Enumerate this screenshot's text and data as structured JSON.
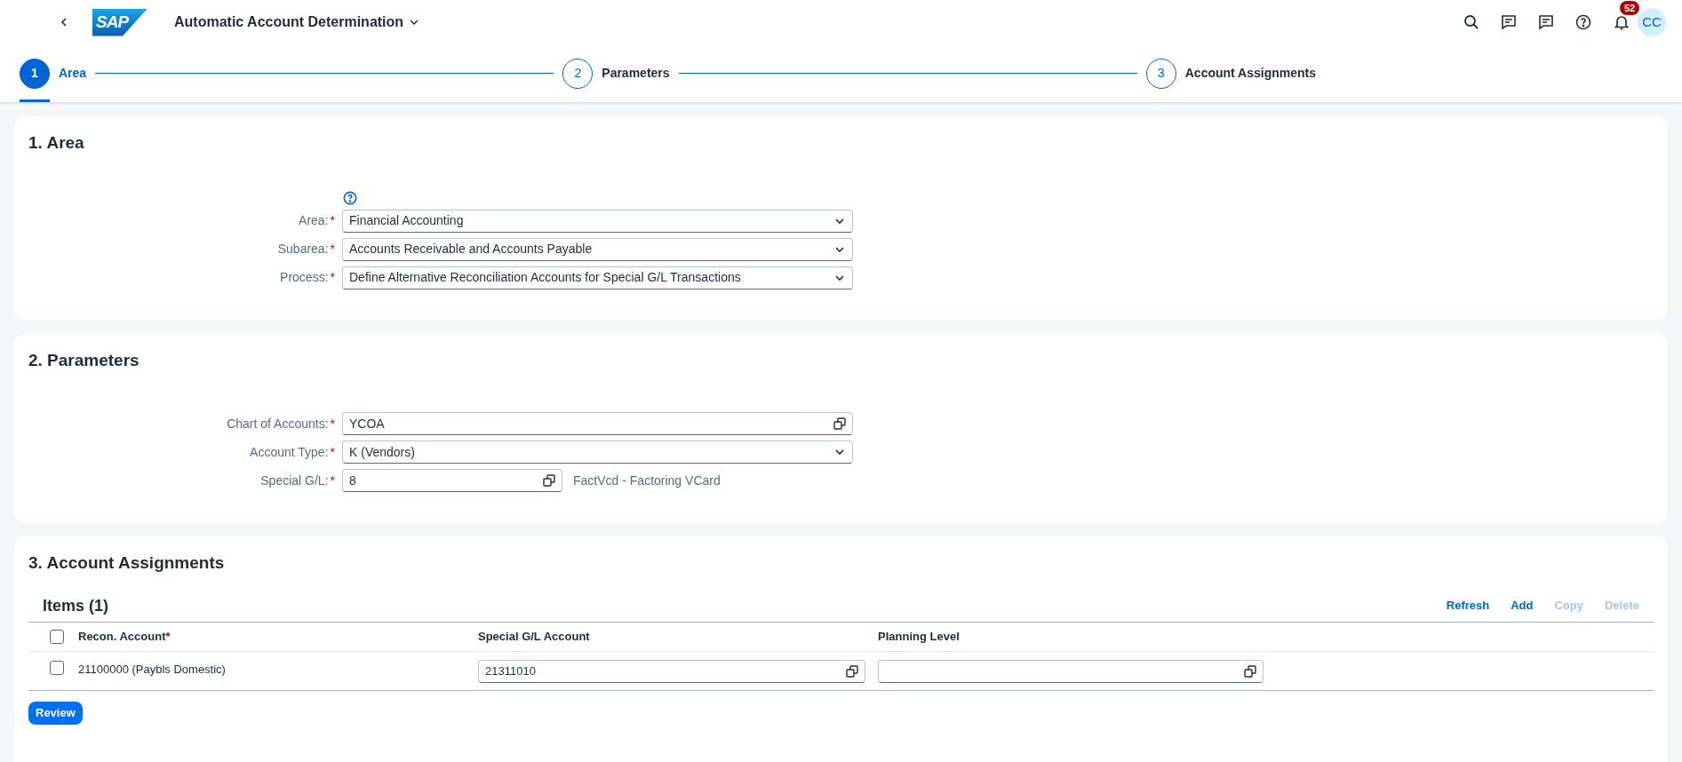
{
  "shell": {
    "logo": "SAP",
    "title": "Automatic Account Determination",
    "notification_count": "52",
    "avatar": "CC"
  },
  "steps": [
    {
      "number": "1",
      "label": "Area",
      "selected": true
    },
    {
      "number": "2",
      "label": "Parameters",
      "selected": false
    },
    {
      "number": "3",
      "label": "Account Assignments",
      "selected": false
    }
  ],
  "sections": [
    {
      "title": "1. Area",
      "help": true,
      "fields": [
        {
          "label": "Area:",
          "mark": "*",
          "kind": "select",
          "value": "Financial Accounting"
        },
        {
          "label": "Subarea:",
          "mark": "*",
          "kind": "select",
          "value": "Accounts Receivable and Accounts Payable"
        },
        {
          "label": "Process:",
          "mark": "*",
          "kind": "select",
          "value": "Define Alternative Reconciliation Accounts for Special G/L Transactions"
        }
      ]
    },
    {
      "title": "2. Parameters",
      "help": false,
      "fields": [
        {
          "label": "Chart of Accounts:",
          "mark": "*",
          "kind": "valuehelp",
          "value": "YCOA"
        },
        {
          "label": "Account Type:",
          "mark": "*",
          "kind": "select",
          "value": "K (Vendors)"
        },
        {
          "label": "Special G/L:",
          "mark": "*",
          "kind": "short",
          "value": "8",
          "description": "FactVcd - Factoring VCard"
        }
      ]
    }
  ],
  "assignments": {
    "title": "3. Account Assignments",
    "table_title": "Items (1)",
    "actions": [
      {
        "label": "Refresh",
        "disabled": false
      },
      {
        "label": "Add",
        "disabled": false
      },
      {
        "label": "Copy",
        "disabled": true
      },
      {
        "label": "Delete",
        "disabled": true
      }
    ],
    "select_all_checked": false,
    "columns": [
      {
        "label": "Recon. Account",
        "mark": "*"
      },
      {
        "label": "Special G/L Account"
      },
      {
        "label": "Planning Level"
      }
    ],
    "rows": [
      {
        "checked": false,
        "recon_account": "21100000 (Paybls Domestic)",
        "special_gl_account": "21311010",
        "planning_level": ""
      }
    ]
  },
  "review_button": "Review"
}
